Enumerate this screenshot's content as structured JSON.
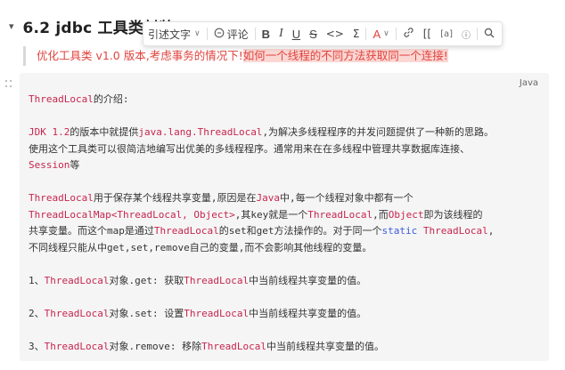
{
  "heading": {
    "caret": "▾",
    "title": "6.2 jdbc 工具类封装 v2.0"
  },
  "toolbar": {
    "cite_label": "引述文字",
    "comment_label": "评论",
    "bold": "B",
    "italic": "I",
    "underline": "U",
    "strike": "S",
    "code": "<>",
    "formula": "Σ",
    "font_color": "A",
    "brackets": "[[",
    "superscript": "[a]",
    "info": "ⓘ"
  },
  "quote": {
    "text": "优化工具类 v1.0 版本,考虑事务的情况下!",
    "highlight": "如何一个线程的不同方法获取同一个连接!"
  },
  "code_block": {
    "language": "Java",
    "lines": [
      [
        {
          "t": "ThreadLocal",
          "c": "var"
        },
        {
          "t": "的介绍:"
        }
      ],
      [],
      [
        {
          "t": "JDK 1.2",
          "c": "var"
        },
        {
          "t": "的版本中就提供"
        },
        {
          "t": "java.lang.ThreadLocal",
          "c": "var"
        },
        {
          "t": ",为解决多线程程序的并发问题提供了一种新的思路。"
        }
      ],
      [
        {
          "t": "使用这个工具类可以很简洁地编写出优美的多线程程序。通常用来在在多线程中管理共享数据库连接、"
        }
      ],
      [
        {
          "t": "Session",
          "c": "var"
        },
        {
          "t": "等"
        }
      ],
      [],
      [
        {
          "t": "ThreadLocal",
          "c": "var"
        },
        {
          "t": "用于保存某个线程共享变量,原因是在"
        },
        {
          "t": "Java",
          "c": "var"
        },
        {
          "t": "中,每一个线程对象中都有一个"
        }
      ],
      [
        {
          "t": "ThreadLocalMap<ThreadLocal, Object>",
          "c": "var"
        },
        {
          "t": ",其key就是一个"
        },
        {
          "t": "ThreadLocal",
          "c": "var"
        },
        {
          "t": ",而"
        },
        {
          "t": "Object",
          "c": "var"
        },
        {
          "t": "即为该线程的"
        }
      ],
      [
        {
          "t": "共享变量。而这个map是通过"
        },
        {
          "t": "ThreadLocal",
          "c": "var"
        },
        {
          "t": "的set和get方法操作的。对于同一个"
        },
        {
          "t": "static",
          "c": "kw"
        },
        {
          "t": " "
        },
        {
          "t": "ThreadLocal",
          "c": "var"
        },
        {
          "t": ","
        }
      ],
      [
        {
          "t": "不同线程只能从中get,set,remove自己的变量,而不会影响其他线程的变量。"
        }
      ],
      [],
      [
        {
          "t": "1、"
        },
        {
          "t": "ThreadLocal",
          "c": "var"
        },
        {
          "t": "对象.get: 获取"
        },
        {
          "t": "ThreadLocal",
          "c": "var"
        },
        {
          "t": "中当前线程共享变量的值。"
        }
      ],
      [],
      [
        {
          "t": "2、"
        },
        {
          "t": "ThreadLocal",
          "c": "var"
        },
        {
          "t": "对象.set: 设置"
        },
        {
          "t": "ThreadLocal",
          "c": "var"
        },
        {
          "t": "中当前线程共享变量的值。"
        }
      ],
      [],
      [
        {
          "t": "3、"
        },
        {
          "t": "ThreadLocal",
          "c": "var"
        },
        {
          "t": "对象.remove: 移除"
        },
        {
          "t": "ThreadLocal",
          "c": "var"
        },
        {
          "t": "中当前线程共享变量的值。"
        }
      ]
    ]
  }
}
